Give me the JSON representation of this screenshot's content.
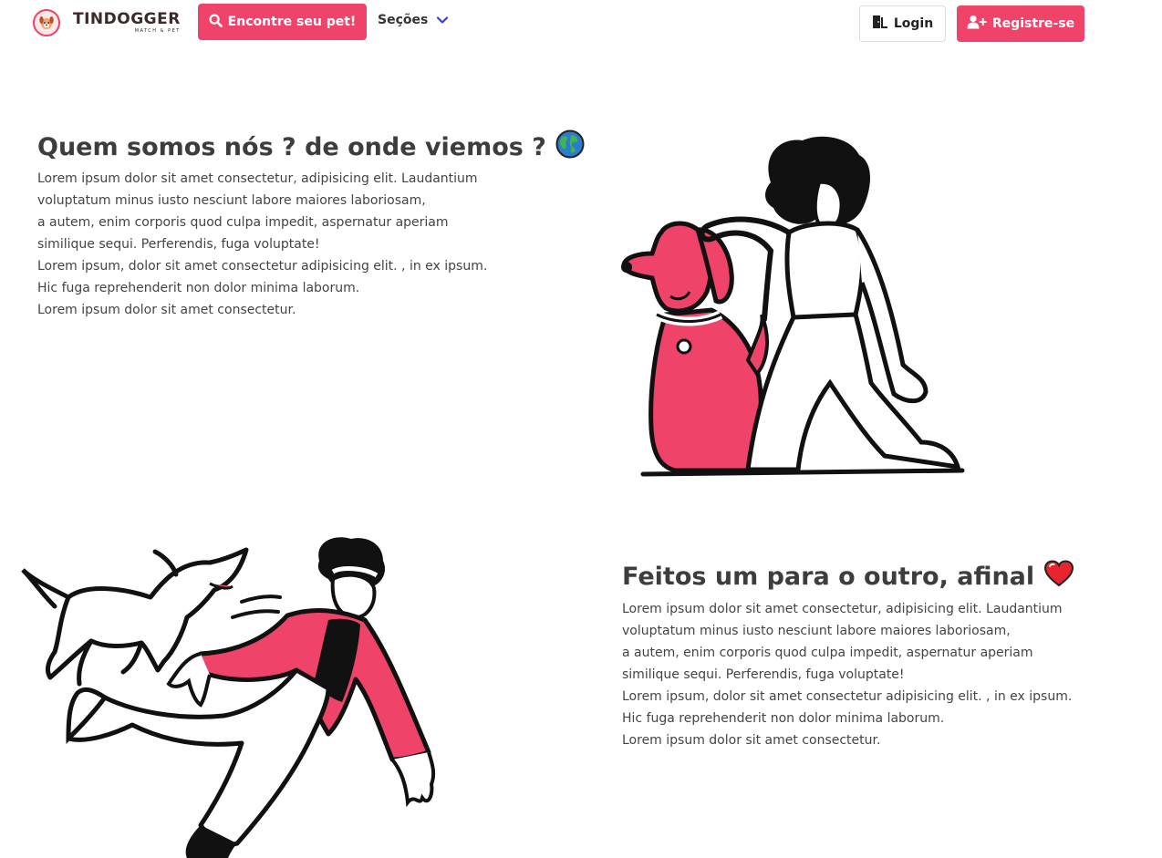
{
  "navbar": {
    "brand_name": "TINDOGGER",
    "brand_tagline": "MATCH & PET",
    "find_pet_label": "Encontre seu pet!",
    "sections_label": "Seções",
    "login_label": "Login",
    "register_label": "Registre-se",
    "icons": {
      "find": "search-icon",
      "sections": "chevron-down-icon",
      "login": "door-icon",
      "register": "user-plus-icon"
    }
  },
  "about": {
    "title": "Quem somos nós ? de onde viemos ?",
    "title_icon": "globe-icon",
    "lines": [
      "Lorem ipsum dolor sit amet consectetur, adipisicing elit. Laudantium",
      "voluptatum minus iusto nesciunt labore maiores laboriosam,",
      "a autem, enim corporis quod culpa impedit, aspernatur aperiam",
      "similique sequi. Perferendis, fuga voluptate!",
      "Lorem ipsum, dolor sit amet consectetur adipisicing elit. , in ex ipsum.",
      "Hic fuga reprehenderit non dolor minima laborum.",
      "Lorem ipsum dolor sit amet consectetur."
    ]
  },
  "match": {
    "title": "Feitos um para o outro, afinal",
    "title_icon": "heart-icon",
    "lines": [
      "Lorem ipsum dolor sit amet consectetur, adipisicing elit. Laudantium",
      "voluptatum minus iusto nesciunt labore maiores laboriosam,",
      "a autem, enim corporis quod culpa impedit, aspernatur aperiam",
      "similique sequi. Perferendis, fuga voluptate!",
      "Lorem ipsum, dolor sit amet consectetur adipisicing elit. , in ex ipsum.",
      "Hic fuga reprehenderit non dolor minima laborum.",
      "Lorem ipsum dolor sit amet consectetur."
    ]
  },
  "colors": {
    "accent": "#f0436a",
    "text_dark": "#3d3d3d",
    "chevron": "#3b3fd1"
  }
}
